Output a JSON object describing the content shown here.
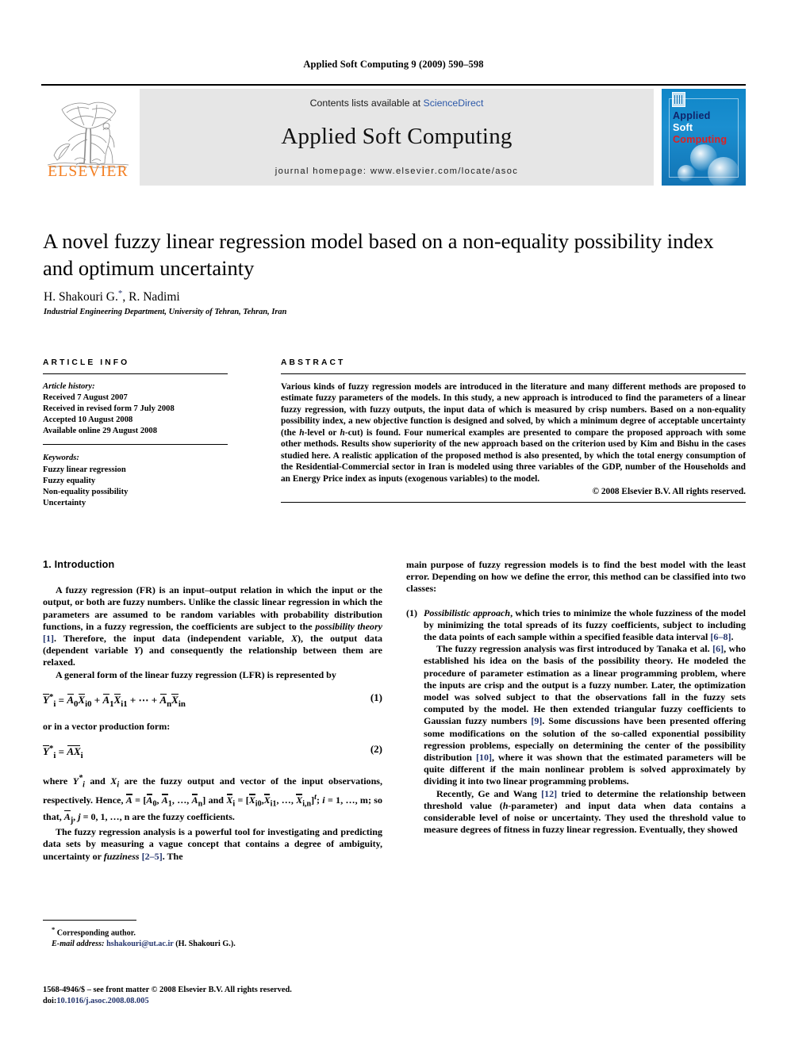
{
  "running_head": "Applied Soft Computing 9 (2009) 590–598",
  "masthead": {
    "contents_prefix": "Contents lists available at ",
    "sciencedirect": "ScienceDirect",
    "journal_title": "Applied Soft Computing",
    "homepage": "journal homepage: www.elsevier.com/locate/asoc",
    "publisher_wordmark": "ELSEVIER",
    "cover": {
      "line1": "Applied",
      "line2": "Soft",
      "line3": "Computing"
    },
    "colors": {
      "elsevier_orange": "#F47E20",
      "link_blue": "#2b57a8",
      "cover_blue": "#1173b4",
      "cover_red": "#e02020"
    }
  },
  "article": {
    "title": "A novel fuzzy linear regression model based on a non-equality possibility index and optimum uncertainty",
    "authors": "H. Shakouri G.",
    "corresponding_marker": "*",
    "authors_rest": ", R. Nadimi",
    "affiliation": "Industrial Engineering Department, University of Tehran, Tehran, Iran"
  },
  "info": {
    "heading": "ARTICLE INFO",
    "history_label": "Article history:",
    "history": [
      "Received 7 August 2007",
      "Received in revised form 7 July 2008",
      "Accepted 10 August 2008",
      "Available online 29 August 2008"
    ],
    "keywords_label": "Keywords:",
    "keywords": [
      "Fuzzy linear regression",
      "Fuzzy equality",
      "Non-equality possibility",
      "Uncertainty"
    ]
  },
  "abstract": {
    "heading": "ABSTRACT",
    "p1_a": "Various kinds of fuzzy regression models are introduced in the literature and many different methods are proposed to estimate fuzzy parameters of the models. In this study, a new approach is introduced to find the parameters of a linear fuzzy regression, with fuzzy outputs, the input data of which is measured by crisp numbers. Based on a non-equality possibility index, a new objective function is designed and solved, by which a minimum degree of acceptable uncertainty (the ",
    "h_level": "h",
    "p1_b": "-level or ",
    "h_cut": "h",
    "p1_c": "-cut) is found. Four numerical examples are presented to compare the proposed approach with some other methods. Results show superiority of the new approach based on the criterion used by Kim and Bishu in the cases studied here. A realistic application of the proposed method is also presented, by which the total energy consumption of the Residential-Commercial sector in Iran is modeled using three variables of the GDP, number of the Households and an Energy Price index as inputs (exogenous variables) to the model.",
    "copyright": "© 2008 Elsevier B.V. All rights reserved."
  },
  "body": {
    "section1_title": "1. Introduction",
    "left": {
      "p1_a": "A fuzzy regression (FR) is an input–output relation in which the input or the output, or both are fuzzy numbers. Unlike the classic linear regression in which the parameters are assumed to be random variables with probability distribution functions, in a fuzzy regression, the coefficients are subject to the ",
      "p1_italic": "possibility theory",
      "p1_b": " ",
      "p1_ref": "[1]",
      "p1_c": ". Therefore, the input data (independent variable, ",
      "p1_X": "X",
      "p1_d": "), the output data (dependent variable ",
      "p1_Y": "Y",
      "p1_e": ") and consequently the relationship between them are relaxed.",
      "p2": "A general form of the linear fuzzy regression (LFR) is represented by",
      "eq1_number": "(1)",
      "after_eq1": "or in a vector production form:",
      "eq2_number": "(2)",
      "p3_a": "where ",
      "p3_b": " and ",
      "p3_c": " are the fuzzy output and vector of the input observations, respectively. Hence, ",
      "p3_d": " and ",
      "p3_e": "; ",
      "p3_f": "i",
      "p3_g": " = 1, …, m; so that, ",
      "p3_h": ", ",
      "p3_i": "j",
      "p3_j": " = 0, 1, …, n are the fuzzy coefficients.",
      "p4_a": "The fuzzy regression analysis is a powerful tool for investigating and predicting data sets by measuring a vague concept that contains a degree of ambiguity, uncertainty or ",
      "p4_italic": "fuzziness",
      "p4_b": " ",
      "p4_ref": "[2–5]",
      "p4_c": ". The"
    },
    "right": {
      "p1": "main purpose of fuzzy regression models is to find the best model with the least error. Depending on how we define the error, this method can be classified into two classes:",
      "item1_mark": "(1)",
      "item1_italic": "Possibilistic approach",
      "item1_a": ", which tries to minimize the whole fuzziness of the model by minimizing the total spreads of its fuzzy coefficients, subject to including the data points of each sample within a specified feasible data interval ",
      "item1_ref": "[6–8]",
      "item1_b": ".",
      "item1_p2_a": "The fuzzy regression analysis was first introduced by Tanaka et al. ",
      "item1_p2_ref": "[6]",
      "item1_p2_b": ", who established his idea on the basis of the possibility theory. He modeled the procedure of parameter estimation as a linear programming problem, where the inputs are crisp and the output is a fuzzy number. Later, the optimization model was solved subject to that the observations fall in the fuzzy sets computed by the model. He then extended triangular fuzzy coefficients to Gaussian fuzzy numbers ",
      "item1_p2_ref2": "[9]",
      "item1_p2_c": ". Some discussions have been presented offering some modifications on the solution of the so-called exponential possibility regression problems, especially on determining the center of the possibility distribution ",
      "item1_p2_ref3": "[10]",
      "item1_p2_d": ", where it was shown that the estimated parameters will be quite different if the main nonlinear problem is solved approximately by dividing it into two linear programming problems.",
      "item1_p3_a": "Recently, Ge and Wang ",
      "item1_p3_ref": "[12]",
      "item1_p3_b": " tried to determine the relationship between threshold value (",
      "item1_p3_h": "h",
      "item1_p3_c": "-parameter) and input data when data contains a considerable level of noise or uncertainty. They used the threshold value to measure degrees of fitness in fuzzy linear regression. Eventually, they showed"
    }
  },
  "footnote": {
    "marker": "*",
    "corresponding": "Corresponding author.",
    "email_label": "E-mail address:",
    "email": "hshakouri@ut.ac.ir",
    "email_suffix": "(H. Shakouri G.)."
  },
  "footer": {
    "frontmatter": "1568-4946/$ – see front matter © 2008 Elsevier B.V. All rights reserved.",
    "doi_label": "doi:",
    "doi": "10.1016/j.asoc.2008.08.005"
  }
}
